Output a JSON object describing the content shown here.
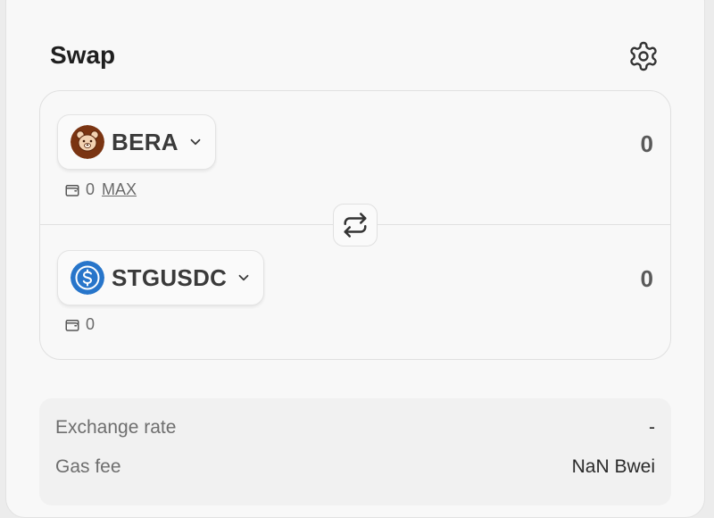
{
  "header": {
    "title": "Swap",
    "settings_icon": "gear-icon"
  },
  "from": {
    "token_symbol": "BERA",
    "token_icon": "bera-bear-icon",
    "amount": "0",
    "balance": "0",
    "max_label": "MAX"
  },
  "to": {
    "token_symbol": "STGUSDC",
    "token_icon": "usdc-icon",
    "amount": "0",
    "balance": "0"
  },
  "switch_icon": "swap-arrows-icon",
  "details": {
    "exchange_rate_label": "Exchange rate",
    "exchange_rate_value": "-",
    "gas_fee_label": "Gas fee",
    "gas_fee_value": "NaN Bwei"
  },
  "colors": {
    "bera_brand": "#7a3412",
    "usdc_brand": "#2775ca"
  }
}
